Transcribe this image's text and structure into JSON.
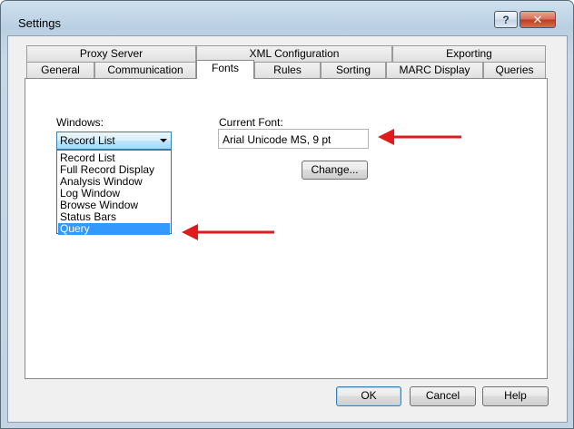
{
  "window": {
    "title": "Settings"
  },
  "titlebar": {
    "help_glyph": "?",
    "close_glyph": "✕"
  },
  "tabs": {
    "back_row": [
      "Proxy Server",
      "XML Configuration",
      "Exporting"
    ],
    "front_row": [
      "General",
      "Communication",
      "Fonts",
      "Rules",
      "Sorting",
      "MARC Display",
      "Queries"
    ],
    "active": "Fonts"
  },
  "fonts_panel": {
    "windows_label": "Windows:",
    "windows_selected": "Record List",
    "windows_options": [
      "Record List",
      "Full Record Display",
      "Analysis Window",
      "Log Window",
      "Browse Window",
      "Status Bars",
      "Query"
    ],
    "highlighted_option": "Query",
    "current_font_label": "Current Font:",
    "current_font_value": "Arial Unicode MS, 9 pt",
    "change_label": "Change..."
  },
  "footer": {
    "ok_label": "OK",
    "cancel_label": "Cancel",
    "help_label": "Help"
  },
  "annotations": {
    "arrow_color": "#e01b1b"
  },
  "colors": {
    "selection": "#3399ff",
    "title_bar": "#c6d7e6"
  }
}
